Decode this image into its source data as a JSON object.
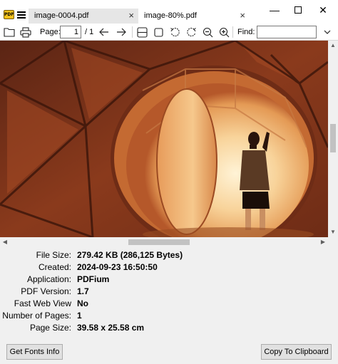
{
  "tabs": [
    {
      "label": "image-0004.pdf",
      "close": "×"
    },
    {
      "label": "image-80%.pdf",
      "close": "×"
    }
  ],
  "window_controls": {
    "minimize": "—",
    "maximize": "",
    "close": "✕"
  },
  "app_icon_text": "PDF",
  "toolbar": {
    "page_label": "Page:",
    "page_value": "1",
    "page_total": "/ 1",
    "find_label": "Find:",
    "find_value": ""
  },
  "icons": [
    "open-folder-icon",
    "print-icon",
    "arrow-left-icon",
    "arrow-right-icon",
    "fit-width-icon",
    "fit-page-icon",
    "rotate-left-icon",
    "rotate-right-icon",
    "zoom-out-icon",
    "zoom-in-icon"
  ],
  "properties": [
    {
      "label": "File Size:",
      "value": "279.42 KB (286,125 Bytes)"
    },
    {
      "label": "Created:",
      "value": "2024-09-23 16:50:50"
    },
    {
      "label": "Application:",
      "value": "PDFium"
    },
    {
      "label": "PDF Version:",
      "value": "1.7"
    },
    {
      "label": "Fast Web View",
      "value": "No"
    },
    {
      "label": "Number of Pages:",
      "value": "1"
    },
    {
      "label": "Page Size:",
      "value": "39.58 x 25.58 cm"
    }
  ],
  "buttons": {
    "get_fonts": "Get Fonts Info",
    "copy_clipboard": "Copy To Clipboard"
  },
  "colors": {
    "accent": "#f3c21b",
    "photo_dark": "#4a1e0e",
    "photo_warm": "#e08a4c",
    "photo_light": "#fbe6b8"
  }
}
